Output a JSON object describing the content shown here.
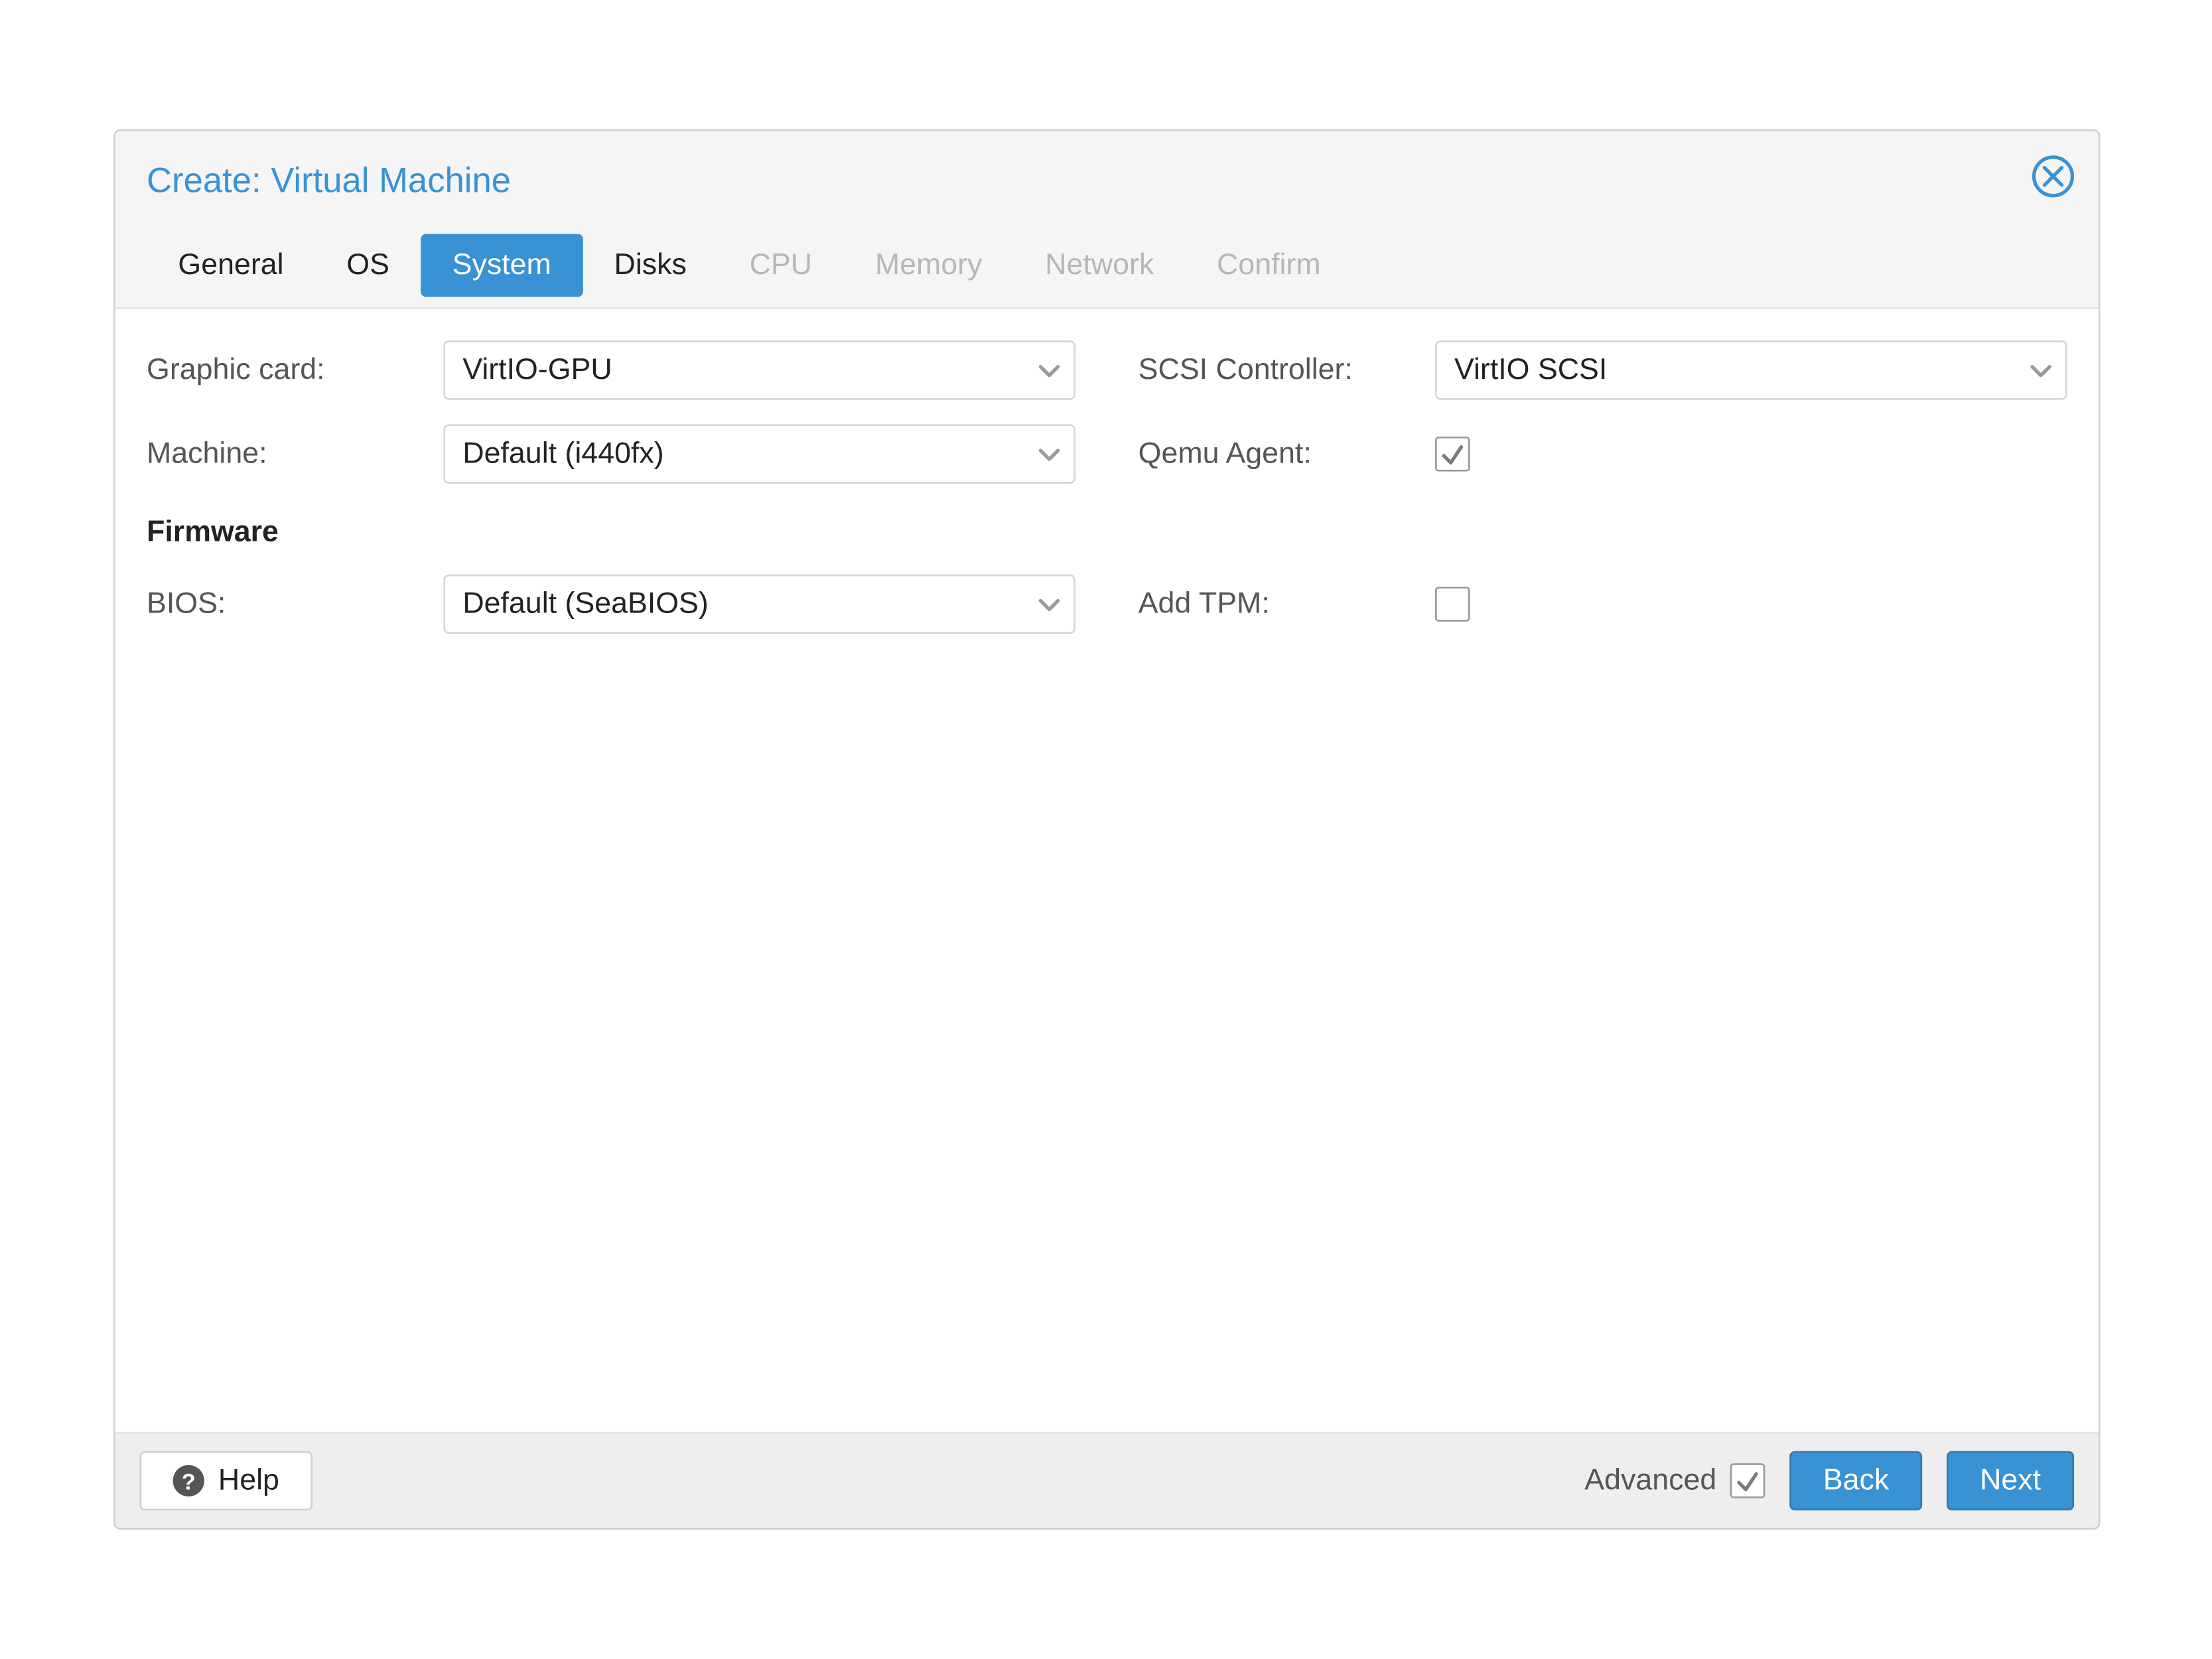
{
  "dialog": {
    "title": "Create: Virtual Machine"
  },
  "tabs": [
    {
      "label": "General",
      "state": "enabled"
    },
    {
      "label": "OS",
      "state": "enabled"
    },
    {
      "label": "System",
      "state": "active"
    },
    {
      "label": "Disks",
      "state": "enabled"
    },
    {
      "label": "CPU",
      "state": "disabled"
    },
    {
      "label": "Memory",
      "state": "disabled"
    },
    {
      "label": "Network",
      "state": "disabled"
    },
    {
      "label": "Confirm",
      "state": "disabled"
    }
  ],
  "form": {
    "graphic_card": {
      "label": "Graphic card:",
      "value": "VirtIO-GPU"
    },
    "scsi_controller": {
      "label": "SCSI Controller:",
      "value": "VirtIO SCSI"
    },
    "machine": {
      "label": "Machine:",
      "value": "Default (i440fx)"
    },
    "qemu_agent": {
      "label": "Qemu Agent:",
      "checked": true
    },
    "firmware_heading": "Firmware",
    "bios": {
      "label": "BIOS:",
      "value": "Default (SeaBIOS)"
    },
    "add_tpm": {
      "label": "Add TPM:",
      "checked": false
    }
  },
  "footer": {
    "help_label": "Help",
    "advanced_label": "Advanced",
    "advanced_checked": true,
    "back_label": "Back",
    "next_label": "Next"
  }
}
